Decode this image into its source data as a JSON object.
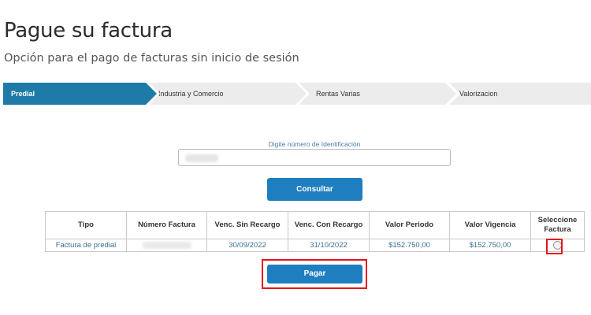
{
  "header": {
    "title": "Pague su factura",
    "subtitle": "Opción para el pago de facturas sin inicio de sesión"
  },
  "steps": [
    {
      "label": "Predial",
      "active": true
    },
    {
      "label": "Industria y Comercio",
      "active": false
    },
    {
      "label": "Rentas Varias",
      "active": false
    },
    {
      "label": "Valorizacion",
      "active": false
    }
  ],
  "search": {
    "label": "Digite número de Identificación",
    "value_redacted": true,
    "button_label": "Consultar"
  },
  "table": {
    "headers": [
      "Tipo",
      "Número Factura",
      "Venc. Sin Recargo",
      "Venc. Con Recargo",
      "Valor Periodo",
      "Valor Vigencia",
      "Seleccione Factura"
    ],
    "rows": [
      {
        "tipo": "Factura de predial",
        "numero_redacted": true,
        "venc_sin_recargo": "30/09/2022",
        "venc_con_recargo": "31/10/2022",
        "valor_periodo": "$152.750,00",
        "valor_vigencia": "$152.750,00",
        "selected": false
      }
    ]
  },
  "actions": {
    "pay_label": "Pagar"
  },
  "colors": {
    "primary": "#1e7ec0",
    "active_step": "#1e7ba8",
    "highlight": "#e5141c"
  }
}
